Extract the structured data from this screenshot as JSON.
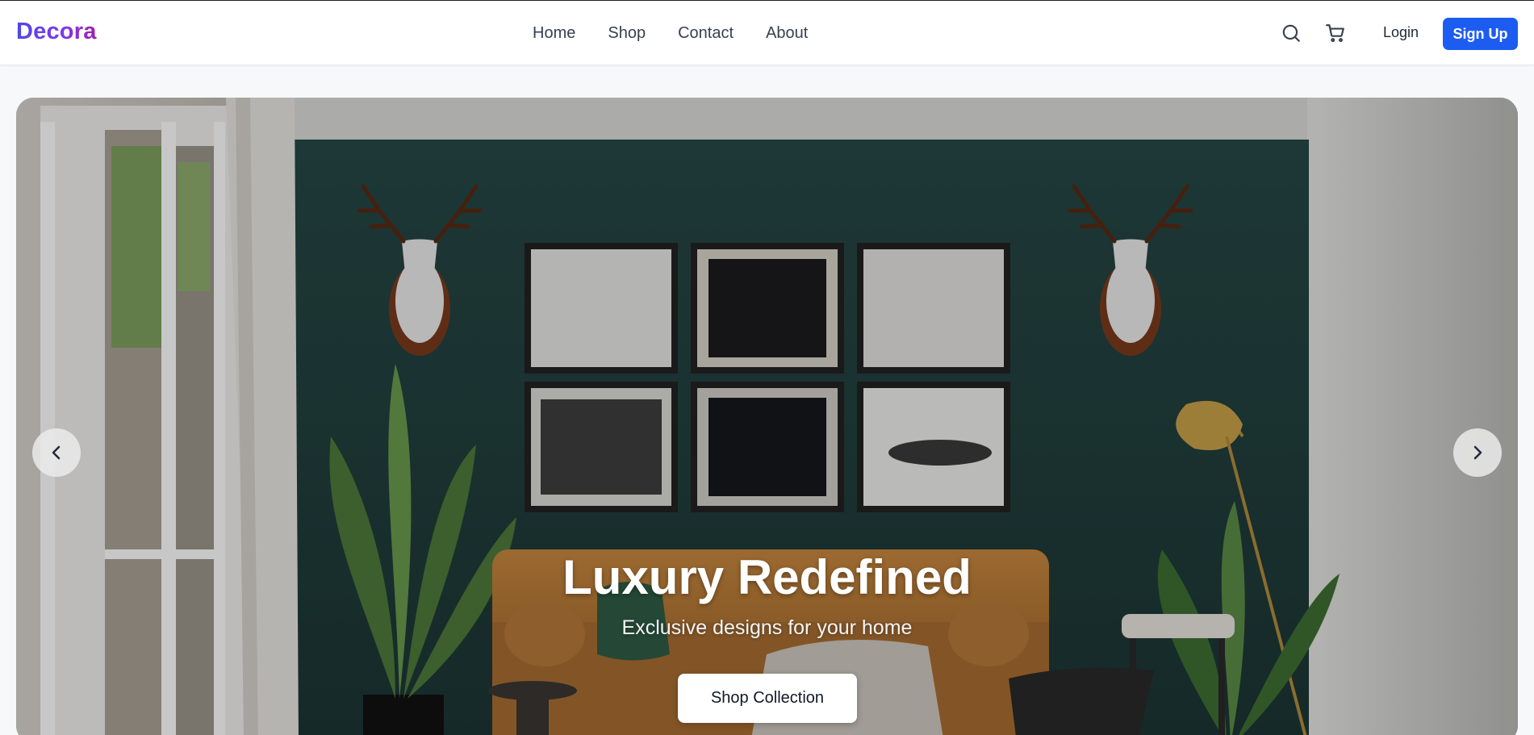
{
  "header": {
    "logo": "Decora",
    "nav": [
      "Home",
      "Shop",
      "Contact",
      "About"
    ],
    "icons": [
      "search-icon",
      "cart-icon"
    ],
    "login_label": "Login",
    "signup_label": "Sign Up"
  },
  "hero": {
    "title": "Luxury Redefined",
    "subtitle": "Exclusive designs for your home",
    "cta_label": "Shop Collection",
    "prev_icon": "chevron-left-icon",
    "next_icon": "chevron-right-icon"
  },
  "colors": {
    "brand_gradient_start": "#4f46e5",
    "brand_gradient_end": "#a21caf",
    "primary_button": "#1d5cf0",
    "wall": "#1f3a38"
  }
}
